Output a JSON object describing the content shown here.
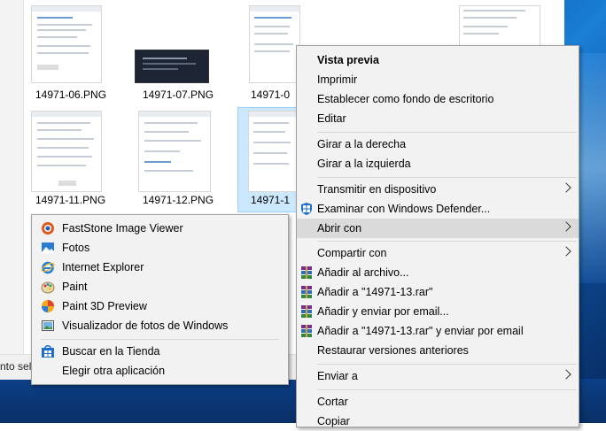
{
  "thumbnails": [
    {
      "label": "14971-06.PNG"
    },
    {
      "label": "14971-07.PNG"
    },
    {
      "label": "14971-0"
    },
    {
      "label": "14971-11.PNG"
    },
    {
      "label": "14971-12.PNG"
    },
    {
      "label": "14971-1"
    }
  ],
  "status": {
    "text": "nto sele"
  },
  "context_menu": {
    "items": [
      {
        "label": "Vista previa"
      },
      {
        "label": "Imprimir"
      },
      {
        "label": "Establecer como fondo de escritorio"
      },
      {
        "label": "Editar"
      },
      {
        "label": "Girar a la derecha"
      },
      {
        "label": "Girar a la izquierda"
      },
      {
        "label": "Transmitir en dispositivo"
      },
      {
        "label": "Examinar con Windows Defender..."
      },
      {
        "label": "Abrir con"
      },
      {
        "label": "Compartir con"
      },
      {
        "label": "Añadir al archivo..."
      },
      {
        "label": "Añadir a \"14971-13.rar\""
      },
      {
        "label": "Añadir y enviar por email..."
      },
      {
        "label": "Añadir a \"14971-13.rar\" y enviar por email"
      },
      {
        "label": "Restaurar versiones anteriores"
      },
      {
        "label": "Enviar a"
      },
      {
        "label": "Cortar"
      },
      {
        "label": "Copiar"
      }
    ]
  },
  "open_with_menu": {
    "items": [
      {
        "label": "FastStone Image Viewer",
        "icon": "faststone-icon"
      },
      {
        "label": "Fotos",
        "icon": "photos-icon"
      },
      {
        "label": "Internet Explorer",
        "icon": "internet-explorer-icon"
      },
      {
        "label": "Paint",
        "icon": "paint-icon"
      },
      {
        "label": "Paint 3D Preview",
        "icon": "paint3d-icon"
      },
      {
        "label": "Visualizador de fotos de Windows",
        "icon": "photo-viewer-icon"
      },
      {
        "label": "Buscar en la Tienda",
        "icon": "store-icon"
      },
      {
        "label": "Elegir otra aplicación"
      }
    ]
  }
}
